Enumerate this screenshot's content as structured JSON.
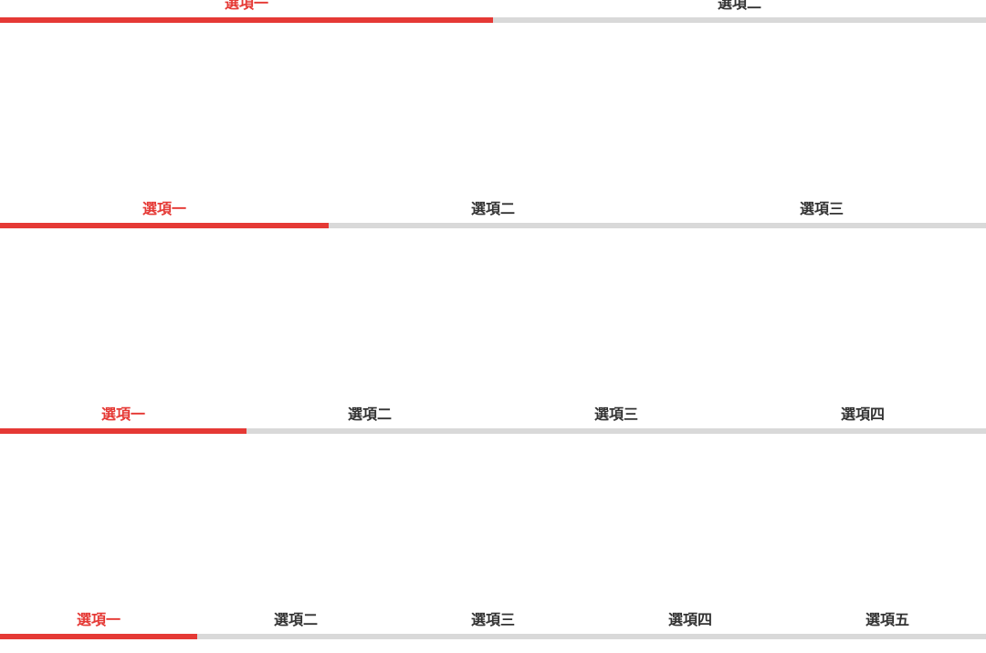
{
  "colors": {
    "active": "#e53935",
    "inactive_text": "#333333",
    "track": "#d9d9d9"
  },
  "tabbars": [
    {
      "tabs": [
        {
          "label": "選項一",
          "active": true
        },
        {
          "label": "選項二",
          "active": false
        }
      ]
    },
    {
      "tabs": [
        {
          "label": "選項一",
          "active": true
        },
        {
          "label": "選項二",
          "active": false
        },
        {
          "label": "選項三",
          "active": false
        }
      ]
    },
    {
      "tabs": [
        {
          "label": "選項一",
          "active": true
        },
        {
          "label": "選項二",
          "active": false
        },
        {
          "label": "選項三",
          "active": false
        },
        {
          "label": "選項四",
          "active": false
        }
      ]
    },
    {
      "tabs": [
        {
          "label": "選項一",
          "active": true
        },
        {
          "label": "選項二",
          "active": false
        },
        {
          "label": "選項三",
          "active": false
        },
        {
          "label": "選項四",
          "active": false
        },
        {
          "label": "選項五",
          "active": false
        }
      ]
    }
  ]
}
